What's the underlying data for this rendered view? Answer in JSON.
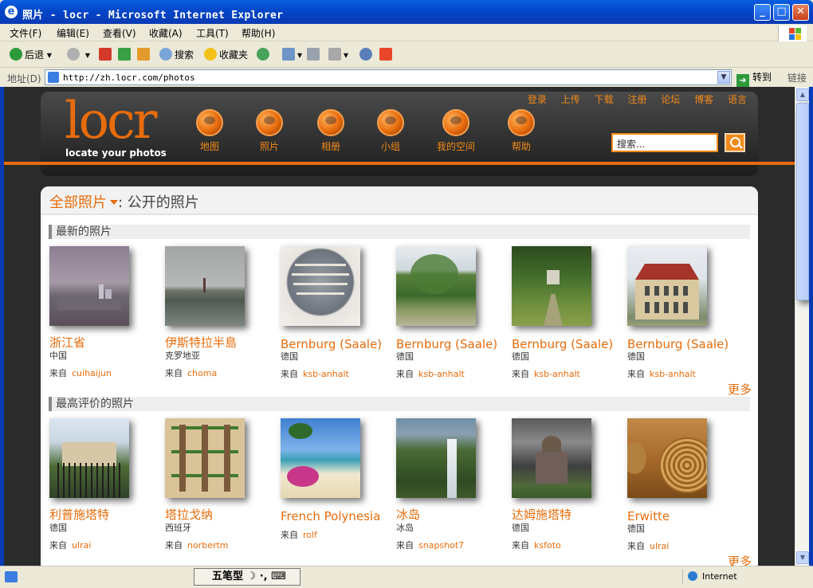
{
  "window": {
    "title": "照片 - locr - Microsoft Internet Explorer"
  },
  "menu": [
    "文件(F)",
    "编辑(E)",
    "查看(V)",
    "收藏(A)",
    "工具(T)",
    "帮助(H)"
  ],
  "toolbar": {
    "back": "后退",
    "search": "搜索",
    "favorites": "收藏夹"
  },
  "address": {
    "label": "地址(D)",
    "url": "http://zh.locr.com/photos",
    "go": "转到",
    "links": "链接"
  },
  "site": {
    "logo": "locr",
    "tagline": "locate your photos",
    "toplinks": [
      "登录",
      "上传",
      "下载",
      "注册",
      "论坛",
      "博客",
      "语言"
    ],
    "nav": [
      "地图",
      "照片",
      "相册",
      "小组",
      "我的空间",
      "帮助"
    ],
    "search_placeholder": "搜索...",
    "accent": "#e86c0c"
  },
  "breadcrumb": {
    "all": "全部照片",
    "current": ": 公开的照片"
  },
  "sections": [
    {
      "title": "最新的照片",
      "more": "更多",
      "photos": [
        {
          "place": "浙江省",
          "country": "中国",
          "from_label": "来自",
          "user": "cuihaijun"
        },
        {
          "place": "伊斯特拉半島",
          "country": "克罗地亚",
          "from_label": "来自",
          "user": "choma"
        },
        {
          "place": "Bernburg (Saale)",
          "country": "德国",
          "from_label": "来自",
          "user": "ksb-anhalt"
        },
        {
          "place": "Bernburg (Saale)",
          "country": "德国",
          "from_label": "来自",
          "user": "ksb-anhalt"
        },
        {
          "place": "Bernburg (Saale)",
          "country": "德国",
          "from_label": "来自",
          "user": "ksb-anhalt"
        },
        {
          "place": "Bernburg (Saale)",
          "country": "德国",
          "from_label": "来自",
          "user": "ksb-anhalt"
        }
      ]
    },
    {
      "title": "最高评价的照片",
      "more": "更多",
      "photos": [
        {
          "place": "利普施塔特",
          "country": "德国",
          "from_label": "来自",
          "user": "ulrai"
        },
        {
          "place": "塔拉戈纳",
          "country": "西班牙",
          "from_label": "来自",
          "user": "norbertm"
        },
        {
          "place": "French Polynesia",
          "country": "",
          "from_label": "来自",
          "user": "rolf"
        },
        {
          "place": "冰岛",
          "country": "冰岛",
          "from_label": "来自",
          "user": "snapshot7"
        },
        {
          "place": "达姆施塔特",
          "country": "德国",
          "from_label": "来自",
          "user": "ksfoto"
        },
        {
          "place": "Erwitte",
          "country": "德国",
          "from_label": "来自",
          "user": "ulrai"
        }
      ]
    }
  ],
  "status": {
    "ime": "五笔型",
    "zone": "Internet"
  }
}
